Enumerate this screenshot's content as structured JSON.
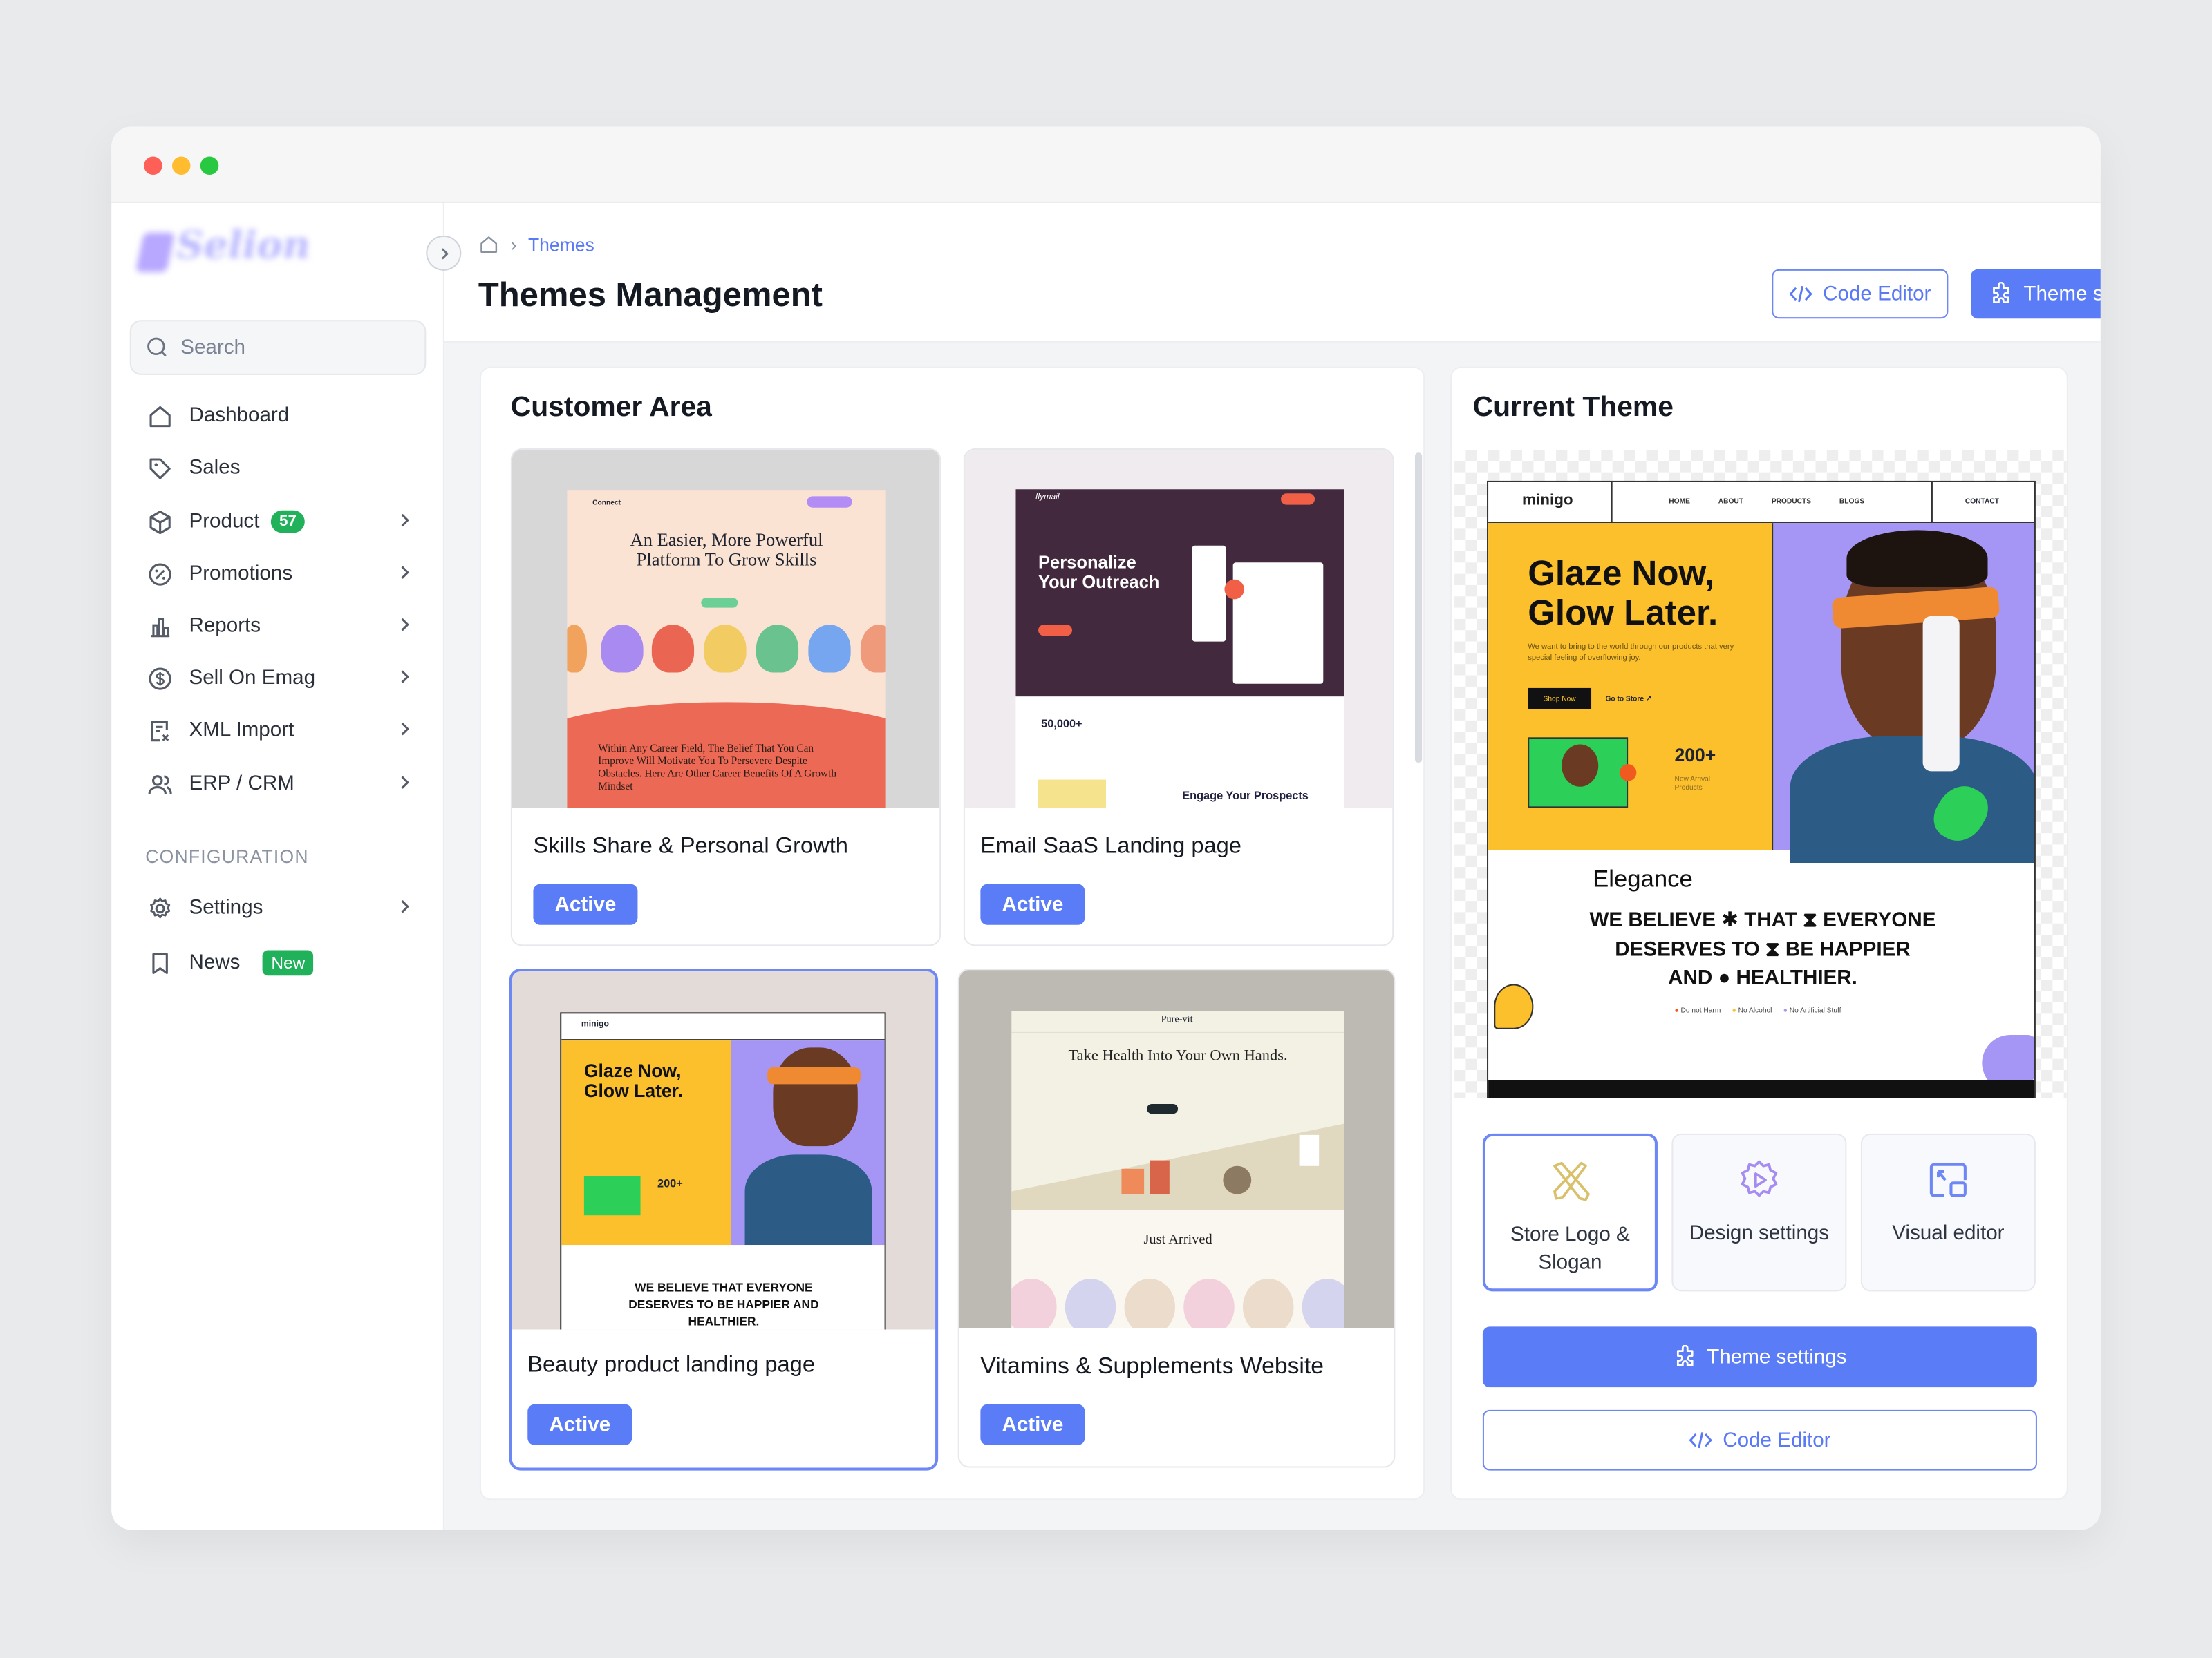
{
  "window": {
    "controls": [
      "close",
      "minimize",
      "maximize"
    ],
    "colors": {
      "close": "#fe5f57",
      "minimize": "#febc2e",
      "maximize": "#28c840"
    }
  },
  "sidebar": {
    "logo_text": "Selion",
    "search_placeholder": "Search",
    "items": [
      {
        "label": "Dashboard",
        "icon": "home-icon"
      },
      {
        "label": "Sales",
        "icon": "tag-icon"
      },
      {
        "label": "Product",
        "icon": "box-icon",
        "badge": "57",
        "chevron": true
      },
      {
        "label": "Promotions",
        "icon": "percent-icon",
        "chevron": true
      },
      {
        "label": "Reports",
        "icon": "chart-bar-icon",
        "chevron": true
      },
      {
        "label": "Sell On Emag",
        "icon": "dollar-icon",
        "chevron": true
      },
      {
        "label": "XML Import",
        "icon": "file-import-icon",
        "chevron": true
      },
      {
        "label": "ERP / CRM",
        "icon": "users-icon",
        "chevron": true
      }
    ],
    "config_heading": "CONFIGURATION",
    "config_items": [
      {
        "label": "Settings",
        "icon": "gear-icon",
        "chevron": true
      },
      {
        "label": "News",
        "icon": "bookmark-icon",
        "badge": "New"
      }
    ]
  },
  "header": {
    "breadcrumb": [
      "Themes"
    ],
    "title": "Themes Management",
    "code_editor_label": "Code Editor",
    "theme_settings_label": "Theme settings"
  },
  "customer_area": {
    "title": "Customer Area",
    "themes": [
      {
        "name": "Skills Share & Personal Growth",
        "status": "Active",
        "preview": {
          "brand": "Connect",
          "headline": "An Easier, More Powerful Platform To Grow Skills",
          "body": "Within Any Career Field, The Belief That You Can Improve Will Motivate You To Persevere Despite Obstacles. Here Are Other Career Benefits Of A Growth Mindset"
        }
      },
      {
        "name": "Email SaaS Landing page",
        "status": "Active",
        "preview": {
          "brand": "flymail",
          "headline": "Personalize Your Outreach",
          "stat": "50,000+",
          "sub": "Engage Your Prospects"
        }
      },
      {
        "name": "Beauty product landing page",
        "status": "Active",
        "selected": true,
        "preview": {
          "brand": "minigo",
          "headline": "Glaze Now, Glow Later.",
          "stat": "200+",
          "body": "WE BELIEVE THAT EVERYONE DESERVES TO BE HAPPIER AND HEALTHIER."
        }
      },
      {
        "name": "Vitamins & Supplements Website",
        "status": "Active",
        "preview": {
          "brand": "Pure-vit",
          "headline": "Take Health Into Your Own Hands.",
          "sub": "Just Arrived"
        }
      }
    ]
  },
  "current_theme": {
    "title": "Current Theme",
    "preview": {
      "brand": "minigo",
      "nav": [
        "HOME",
        "ABOUT",
        "PRODUCTS",
        "BLOGS"
      ],
      "contact": "CONTACT",
      "headline1": "Glaze Now,",
      "headline2": "Glow Later.",
      "tagline": "We want to bring to the world through our products that very special feeling of overflowing joy.",
      "shop_now": "Shop Now",
      "go_to_store": "Go to Store ↗",
      "stat": "200+",
      "stat_label": "New Arrival Products",
      "theme_name": "Elegance",
      "believe": [
        "WE BELIEVE ✱ THAT ⧗ EVERYONE",
        "DESERVES TO ⧗ BE HAPPIER",
        "AND ● HEALTHIER."
      ],
      "bullets": [
        "Do not Harm",
        "No Alcohol",
        "No Artificial Stuff"
      ]
    },
    "tiles": [
      {
        "label": "Store Logo & Slogan",
        "icon": "pencil-ruler-icon",
        "selected": true
      },
      {
        "label": "Design settings",
        "icon": "gear-play-icon"
      },
      {
        "label": "Visual editor",
        "icon": "window-arrow-icon"
      }
    ],
    "theme_settings_label": "Theme settings",
    "code_editor_label": "Code Editor"
  },
  "colors": {
    "accent": "#5b7cf7",
    "badge_green": "#21b15b"
  }
}
